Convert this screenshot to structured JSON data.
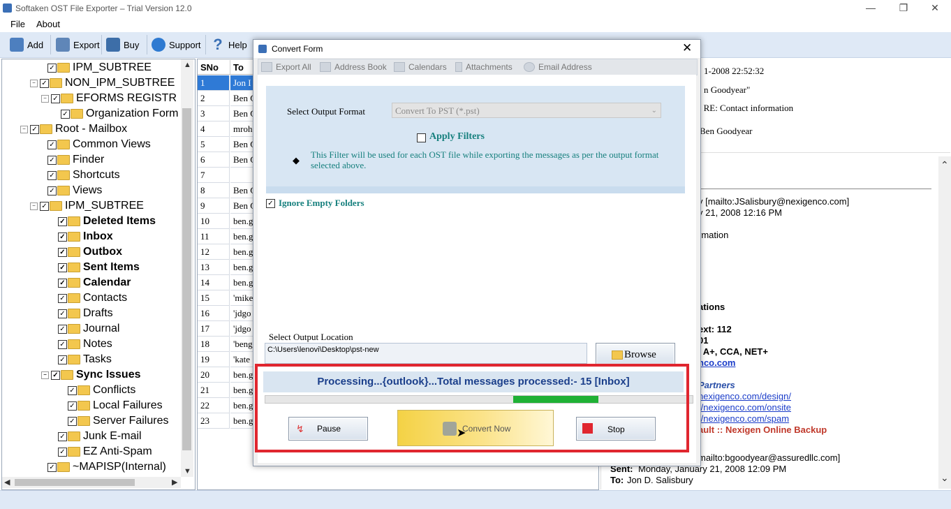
{
  "app": {
    "title": "Softaken OST File Exporter – Trial Version 12.0"
  },
  "menu": [
    "File",
    "About"
  ],
  "toolbar": {
    "add": "Add",
    "export": "Export",
    "buy": "Buy",
    "support": "Support",
    "help": "Help"
  },
  "tree": [
    {
      "label": "IPM_SUBTREE",
      "bold": false
    },
    {
      "label": "NON_IPM_SUBTREE",
      "bold": false
    },
    {
      "label": "EFORMS REGISTR",
      "bold": false
    },
    {
      "label": "Organization Form",
      "bold": false
    },
    {
      "label": "Root - Mailbox",
      "bold": false
    },
    {
      "label": "Common Views",
      "bold": false
    },
    {
      "label": "Finder",
      "bold": false
    },
    {
      "label": "Shortcuts",
      "bold": false
    },
    {
      "label": "Views",
      "bold": false
    },
    {
      "label": "IPM_SUBTREE",
      "bold": false
    },
    {
      "label": "Deleted Items",
      "bold": true
    },
    {
      "label": "Inbox",
      "bold": true
    },
    {
      "label": "Outbox",
      "bold": true
    },
    {
      "label": "Sent Items",
      "bold": true
    },
    {
      "label": "Calendar",
      "bold": true
    },
    {
      "label": "Contacts",
      "bold": false
    },
    {
      "label": "Drafts",
      "bold": false
    },
    {
      "label": "Journal",
      "bold": false
    },
    {
      "label": "Notes",
      "bold": false
    },
    {
      "label": "Tasks",
      "bold": false
    },
    {
      "label": "Sync Issues",
      "bold": true
    },
    {
      "label": "Conflicts",
      "bold": false
    },
    {
      "label": "Local Failures",
      "bold": false
    },
    {
      "label": "Server Failures",
      "bold": false
    },
    {
      "label": "Junk E-mail",
      "bold": false
    },
    {
      "label": "EZ Anti-Spam",
      "bold": false
    },
    {
      "label": "~MAPISP(Internal)",
      "bold": false
    }
  ],
  "grid": {
    "headers": [
      "SNo",
      "To"
    ],
    "rows": [
      {
        "sno": "1",
        "to": "Jon I"
      },
      {
        "sno": "2",
        "to": "Ben G"
      },
      {
        "sno": "3",
        "to": "Ben G"
      },
      {
        "sno": "4",
        "to": "mroh"
      },
      {
        "sno": "5",
        "to": "Ben G"
      },
      {
        "sno": "6",
        "to": "Ben G"
      },
      {
        "sno": "7",
        "to": ""
      },
      {
        "sno": "8",
        "to": "Ben G"
      },
      {
        "sno": "9",
        "to": "Ben G"
      },
      {
        "sno": "10",
        "to": "ben.g"
      },
      {
        "sno": "11",
        "to": "ben.g"
      },
      {
        "sno": "12",
        "to": "ben.g"
      },
      {
        "sno": "13",
        "to": "ben.g"
      },
      {
        "sno": "14",
        "to": "ben.g"
      },
      {
        "sno": "15",
        "to": "'mike"
      },
      {
        "sno": "16",
        "to": "'jdgo"
      },
      {
        "sno": "17",
        "to": "'jdgo"
      },
      {
        "sno": "18",
        "to": "'beng"
      },
      {
        "sno": "19",
        "to": "'kate"
      },
      {
        "sno": "20",
        "to": "ben.g"
      },
      {
        "sno": "21",
        "to": "ben.g"
      },
      {
        "sno": "22",
        "to": "ben.g"
      },
      {
        "sno": "23",
        "to": "ben.g"
      }
    ]
  },
  "preview": {
    "date": "1-2008 22:52:32",
    "from_name": "n Goodyear\"",
    "subject": "- RE: Contact information",
    "to_name": "Ben Goodyear",
    "body": {
      "mailto1": "y [mailto:JSalisbury@nexigenco.com]",
      "sent1": "y 21, 2008 12:16 PM",
      "l3": "rmation",
      "l4": "ations",
      "l5": "ext: 112",
      "l6": "01",
      "l7": ", A+, CCA, NET+",
      "l8": "nco.com",
      "l9": "Partners",
      "l10": "nexigenco.com/design/",
      "l11": "//nexigenco.com/onsite",
      "l12": "//nexigenco.com/spam",
      "l13": "ault :: Nexigen Online Backup",
      "mailto2": "mailto:bgoodyear@assuredllc.com]",
      "sent_label": "Sent:",
      "sent2": "Monday, January 21, 2008 12:09 PM",
      "to_label": "To:",
      "to2": "Jon D. Salisbury"
    }
  },
  "dialog": {
    "title": "Convert Form",
    "tabs": [
      "Export All",
      "Address Book",
      "Calendars",
      "Attachments",
      "Email Address"
    ],
    "output_format_label": "Select Output Format",
    "output_format_value": "Convert To PST (*.pst)",
    "apply_filters": "Apply Filters",
    "filter_note": "This Filter will be used for each OST file while exporting the messages as per the output format selected above.",
    "ignore_empty": "Ignore Empty Folders",
    "output_location_label": "Select Output Location",
    "output_path": "C:\\Users\\lenovi\\Desktop\\pst-new",
    "browse": "Browse",
    "processing": "Processing...{outlook}...Total messages processed:- 15 [Inbox]",
    "progress": 0.2,
    "pause": "Pause",
    "convert_now": "Convert Now",
    "stop": "Stop"
  },
  "colors": {
    "accent_red": "#e0262f",
    "progress_green": "#1fb135",
    "toolbar_bg": "#dfe9f6"
  }
}
